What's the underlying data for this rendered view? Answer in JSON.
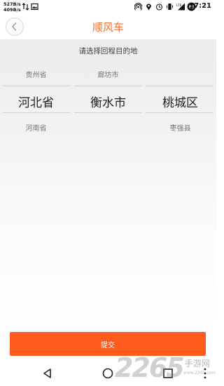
{
  "status_bar": {
    "net_up": "527B/s",
    "net_down": "409B/s",
    "time": "17:21",
    "battery": "83",
    "icons": [
      "data-arrows-icon",
      "image-icon",
      "hotspot-icon",
      "location-icon",
      "alarm-icon",
      "vibrate-icon",
      "lte-signal-icon",
      "battery-icon"
    ]
  },
  "header": {
    "title": "顺风车",
    "back_icon": "chevron-left-icon"
  },
  "picker": {
    "prompt": "请选择回程目的地",
    "columns": [
      {
        "above": "贵州省",
        "selected": "河北省",
        "below": "河南省"
      },
      {
        "above": "廊坊市",
        "selected": "衡水市",
        "below": ""
      },
      {
        "above": "",
        "selected": "桃城区",
        "below": "枣强县"
      }
    ]
  },
  "submit_label": "提交",
  "nav": {
    "back": "triangle-back-icon",
    "home": "circle-home-icon",
    "recents": "square-recents-icon"
  },
  "watermark": {
    "number": "2265",
    "text": "手游网",
    "url": "www.2265.com"
  },
  "colors": {
    "accent": "#ff6b2e",
    "button": "#ff5b1f"
  }
}
